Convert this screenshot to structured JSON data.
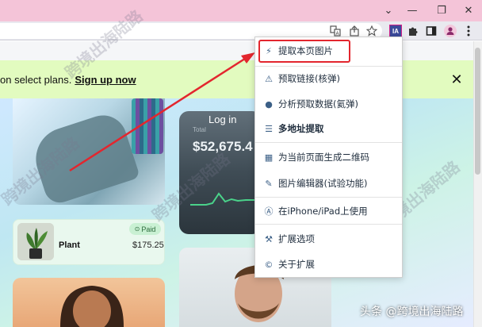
{
  "window": {
    "minimize_glyph": "—",
    "maximize_glyph": "❐",
    "close_glyph": "✕",
    "collapse_glyph": "⌄"
  },
  "toolbar": {
    "icons": [
      "translate-icon",
      "share-icon",
      "bookmark-star-icon",
      "image-assistant-extension-icon",
      "extensions-puzzle-icon",
      "sidepanel-icon",
      "profile-avatar-icon",
      "kebab-menu-icon"
    ],
    "extension_badge": "IA"
  },
  "page": {
    "banner_text": "on select plans.",
    "banner_link": "Sign up now",
    "banner_close": "✕",
    "finance_card": {
      "login_label": "Log in",
      "total_label": "Total",
      "balance": "$52,675.4"
    },
    "plant_card": {
      "name": "Plant",
      "price": "$175.25",
      "status": "Paid"
    }
  },
  "menu": {
    "items": [
      {
        "label": "提取本页图片",
        "icon": "lightning-icon",
        "glyph": "⚡"
      },
      {
        "label": "预取链接(核弹)",
        "icon": "warning-triangle-icon",
        "glyph": "⚠"
      },
      {
        "label": "分析预取数据(氦弹)",
        "icon": "bomb-icon",
        "glyph": "●"
      },
      {
        "label": "多地址提取",
        "icon": "list-icon",
        "glyph": "☰"
      },
      {
        "label": "为当前页面生成二维码",
        "icon": "qrcode-icon",
        "glyph": "▦"
      },
      {
        "label": "图片编辑器(试验功能)",
        "icon": "edit-icon",
        "glyph": "✎"
      },
      {
        "label": "在iPhone/iPad上使用",
        "icon": "app-store-icon",
        "glyph": "Ⓐ"
      },
      {
        "label": "扩展选项",
        "icon": "wrench-icon",
        "glyph": "⚒"
      },
      {
        "label": "关于扩展",
        "icon": "copyright-icon",
        "glyph": "©"
      }
    ]
  },
  "watermarks": {
    "repeat_text": "跨境出海陆路",
    "footer": "头条 @跨境出海陆路"
  },
  "colors": {
    "annotation_red": "#e3262e",
    "banner_bg": "#e2fbbf",
    "titlebar_pink": "#f4c4d8"
  }
}
